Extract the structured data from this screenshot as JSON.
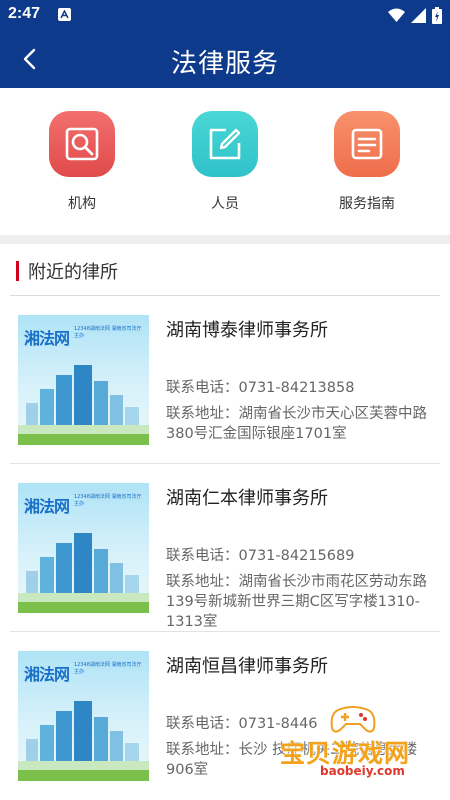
{
  "status_bar": {
    "time": "2:47"
  },
  "header": {
    "title": "法律服务"
  },
  "shortcuts": [
    {
      "label": "机构",
      "icon": "search-document-icon"
    },
    {
      "label": "人员",
      "icon": "edit-icon"
    },
    {
      "label": "服务指南",
      "icon": "guide-list-icon"
    }
  ],
  "section": {
    "title": "附近的律所"
  },
  "firms": [
    {
      "name": "湖南博泰律师事务所",
      "phone": "联系电话：0731-84213858",
      "address": "联系地址：湖南省长沙市天心区芙蓉中路380号汇金国际银座1701室",
      "thumb_brand": "湘法网",
      "thumb_tagline": "12348湖南法网 湖南省司法厅主办"
    },
    {
      "name": "湖南仁本律师事务所",
      "phone": "联系电话：0731-84215689",
      "address": "联系地址：湖南省长沙市雨花区劳动东路139号新城新世界三期C区写字楼1310-1313室",
      "thumb_brand": "湘法网",
      "thumb_tagline": "12348湖南法网 湖南省司法厅主办"
    },
    {
      "name": "湖南恒昌律师事务所",
      "phone": "联系电话：0731-8446",
      "address": "联系地址：长沙                    技厅机关二院信息大楼               906室",
      "thumb_brand": "湘法网",
      "thumb_tagline": "12348湖南法网 湖南省司法厅主办"
    }
  ],
  "watermark": {
    "text": "宝贝游戏网",
    "url": "baobeiy.com"
  },
  "colors": {
    "header_bg": "#0d3a8a",
    "accent_red": "#d0021b",
    "tile_red": "#e04a4a",
    "tile_cyan": "#2ec2c9",
    "tile_orange": "#ef6d4b"
  }
}
